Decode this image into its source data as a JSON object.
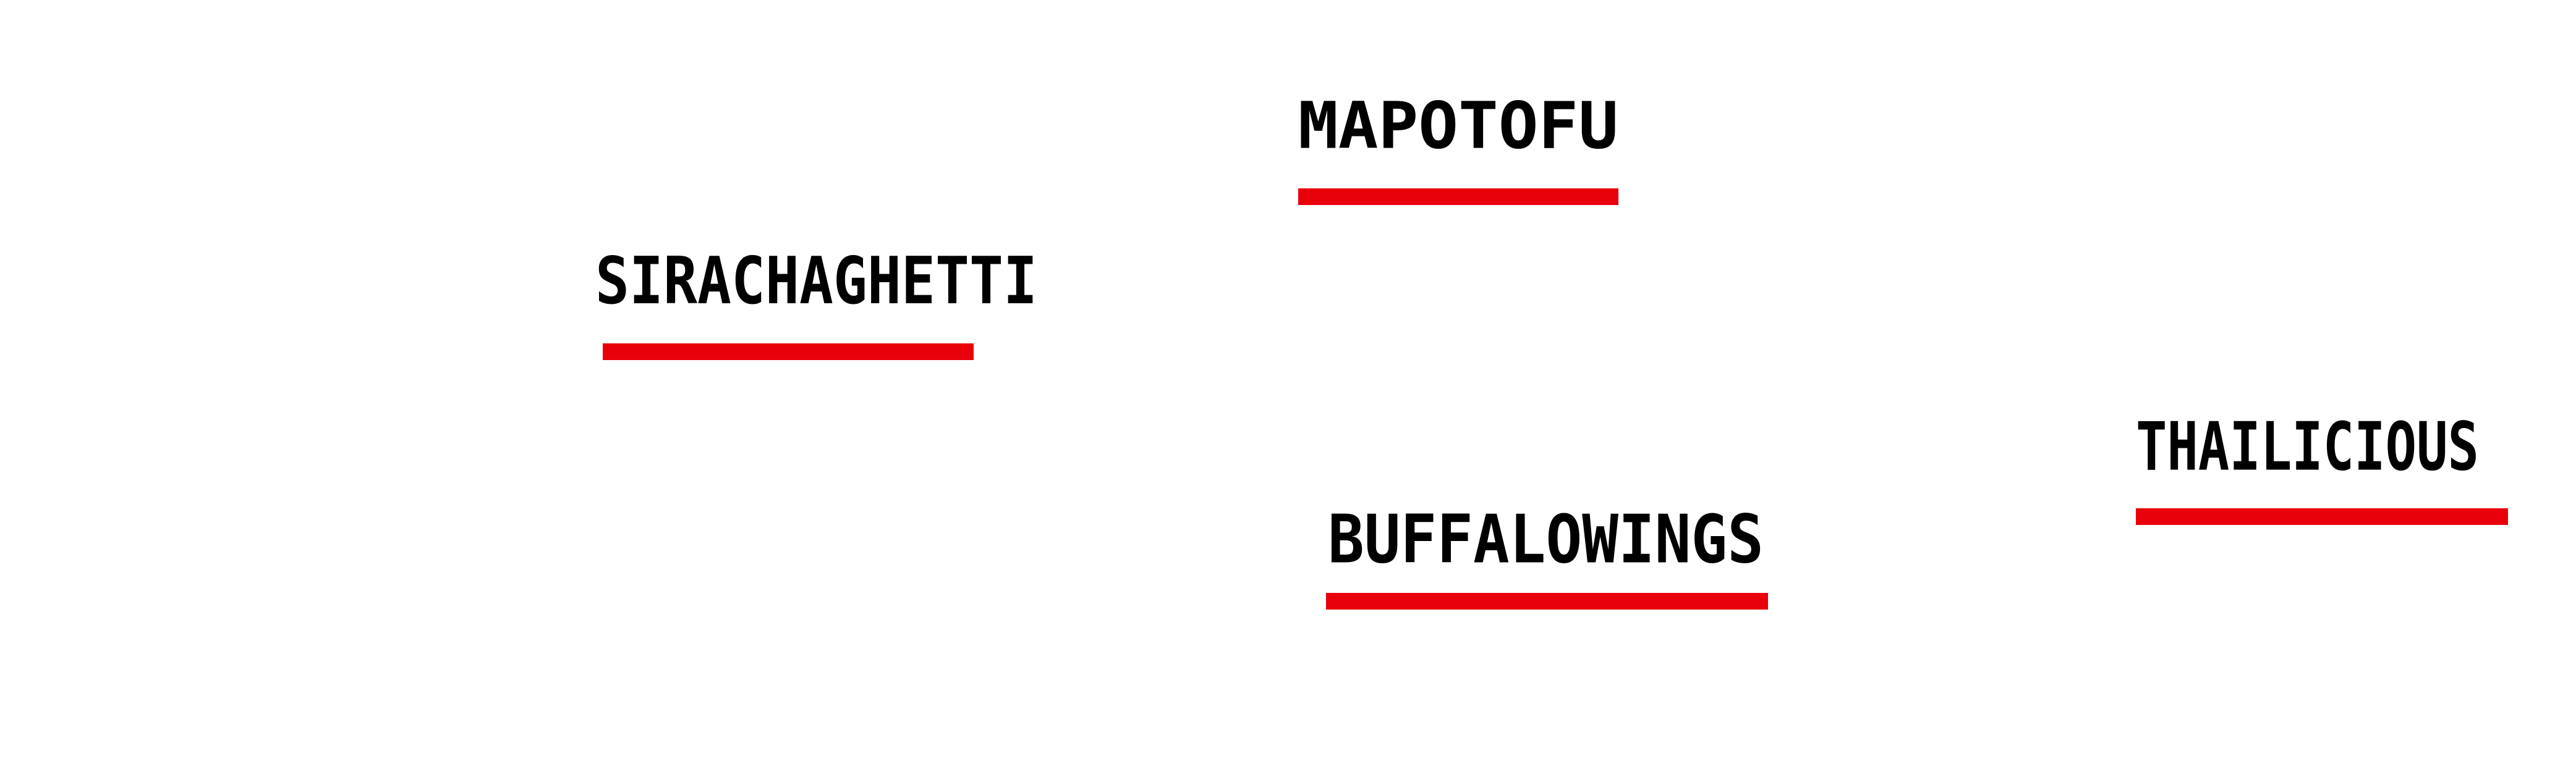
{
  "labels": {
    "mapotofu": "MAPOTOFU",
    "sirachaghetti": "SIRACHAGHETTI",
    "thailicious": "THAILICIOUS",
    "buffalowings": "BUFFALOWINGS"
  },
  "colors": {
    "text": "#000000",
    "underline": "#e8000b",
    "background": "#ffffff"
  }
}
